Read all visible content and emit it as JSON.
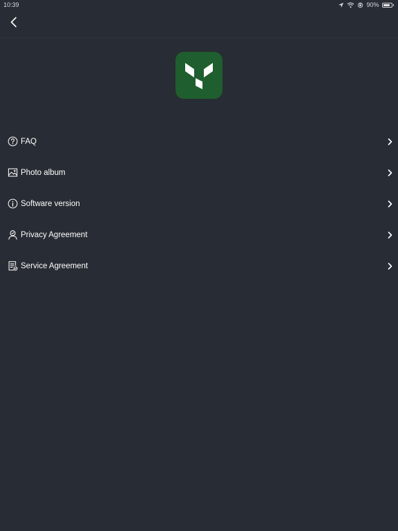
{
  "status_bar": {
    "time": "10:39",
    "battery_percent": "90%",
    "battery_level": 0.9
  },
  "nav": {
    "back_icon": "chevron-left-icon"
  },
  "logo": {
    "icon": "app-logo",
    "color": "#1f5e2e"
  },
  "menu": {
    "items": [
      {
        "label": "FAQ",
        "icon": "question-circle-icon"
      },
      {
        "label": "Photo album",
        "icon": "image-icon"
      },
      {
        "label": "Software version",
        "icon": "info-circle-icon"
      },
      {
        "label": "Privacy Agreement",
        "icon": "user-shield-icon"
      },
      {
        "label": "Service Agreement",
        "icon": "document-check-icon"
      }
    ]
  },
  "colors": {
    "background": "#282c34",
    "text": "#ffffff",
    "brand": "#1f5e2e"
  }
}
